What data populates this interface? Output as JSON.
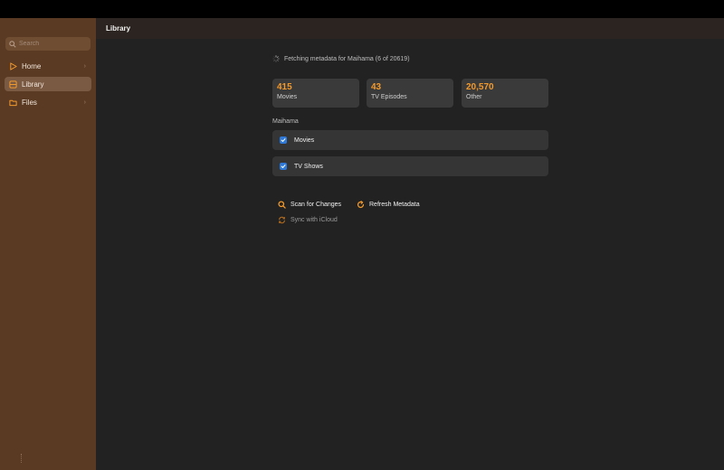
{
  "sidebar": {
    "search_placeholder": "Search",
    "items": [
      {
        "label": "Home",
        "icon": "home-icon",
        "active": false
      },
      {
        "label": "Library",
        "icon": "library-icon",
        "active": true
      },
      {
        "label": "Files",
        "icon": "folder-icon",
        "active": false
      }
    ]
  },
  "header": {
    "title": "Library"
  },
  "status": {
    "text": "Fetching metadata for Maihama (6 of 20619)"
  },
  "stats": [
    {
      "value": "415",
      "label": "Movies"
    },
    {
      "value": "43",
      "label": "TV Episodes"
    },
    {
      "value": "20,570",
      "label": "Other"
    }
  ],
  "library_section": {
    "title": "Maihama",
    "rows": [
      {
        "label": "Movies",
        "checked": true
      },
      {
        "label": "TV Shows",
        "checked": true
      }
    ]
  },
  "actions": {
    "scan": "Scan for Changes",
    "refresh": "Refresh Metadata",
    "sync": "Sync with iCloud"
  },
  "colors": {
    "accent": "#f39a2d",
    "sidebar_bg": "#5a3a22",
    "checkbox": "#2f7ad8"
  }
}
